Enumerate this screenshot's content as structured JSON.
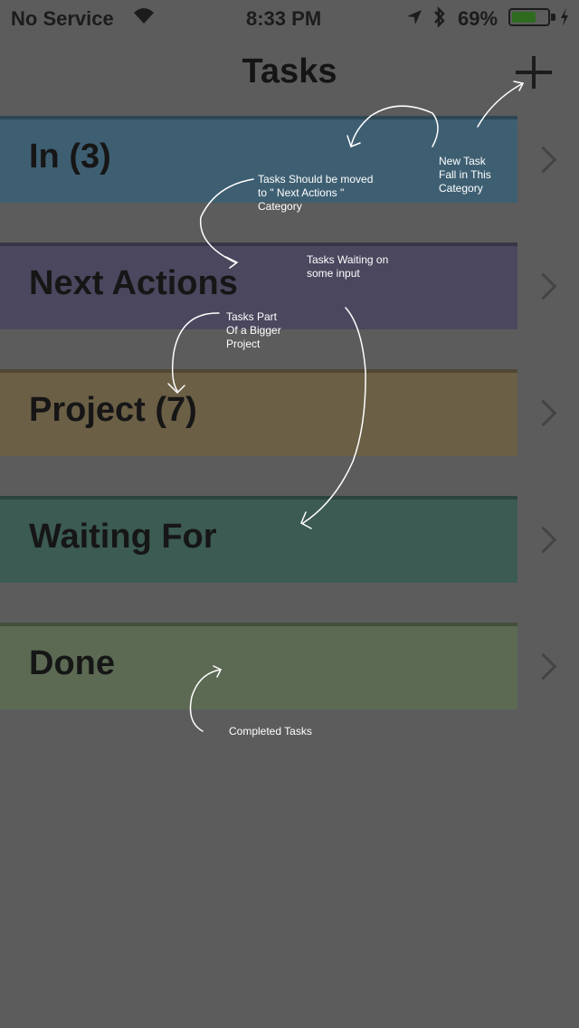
{
  "status_bar": {
    "carrier": "No Service",
    "time": "8:33 PM",
    "battery": "69%",
    "battery_level": 0.69,
    "icons": [
      "wifi-icon",
      "location-icon",
      "bluetooth-icon",
      "battery-icon",
      "charging-icon"
    ]
  },
  "nav": {
    "title": "Tasks",
    "add_icon": "plus-icon"
  },
  "categories": [
    {
      "label": "In (3)",
      "color": "#3e5f72"
    },
    {
      "label": "Next Actions",
      "color": "#4b475e"
    },
    {
      "label": "Project (7)",
      "color": "#6b5f46"
    },
    {
      "label": "Waiting For",
      "color": "#3b5b53"
    },
    {
      "label": "Done",
      "color": "#5c6a53"
    }
  ],
  "annotations": [
    {
      "text": "New Task\nFall in This\nCategory"
    },
    {
      "text": "Tasks Should be moved\nto \" Next Actions \"\nCategory"
    },
    {
      "text": "Tasks Waiting on\nsome input"
    },
    {
      "text": "Tasks Part\nOf a Bigger\nProject"
    },
    {
      "text": "Completed Tasks"
    }
  ]
}
